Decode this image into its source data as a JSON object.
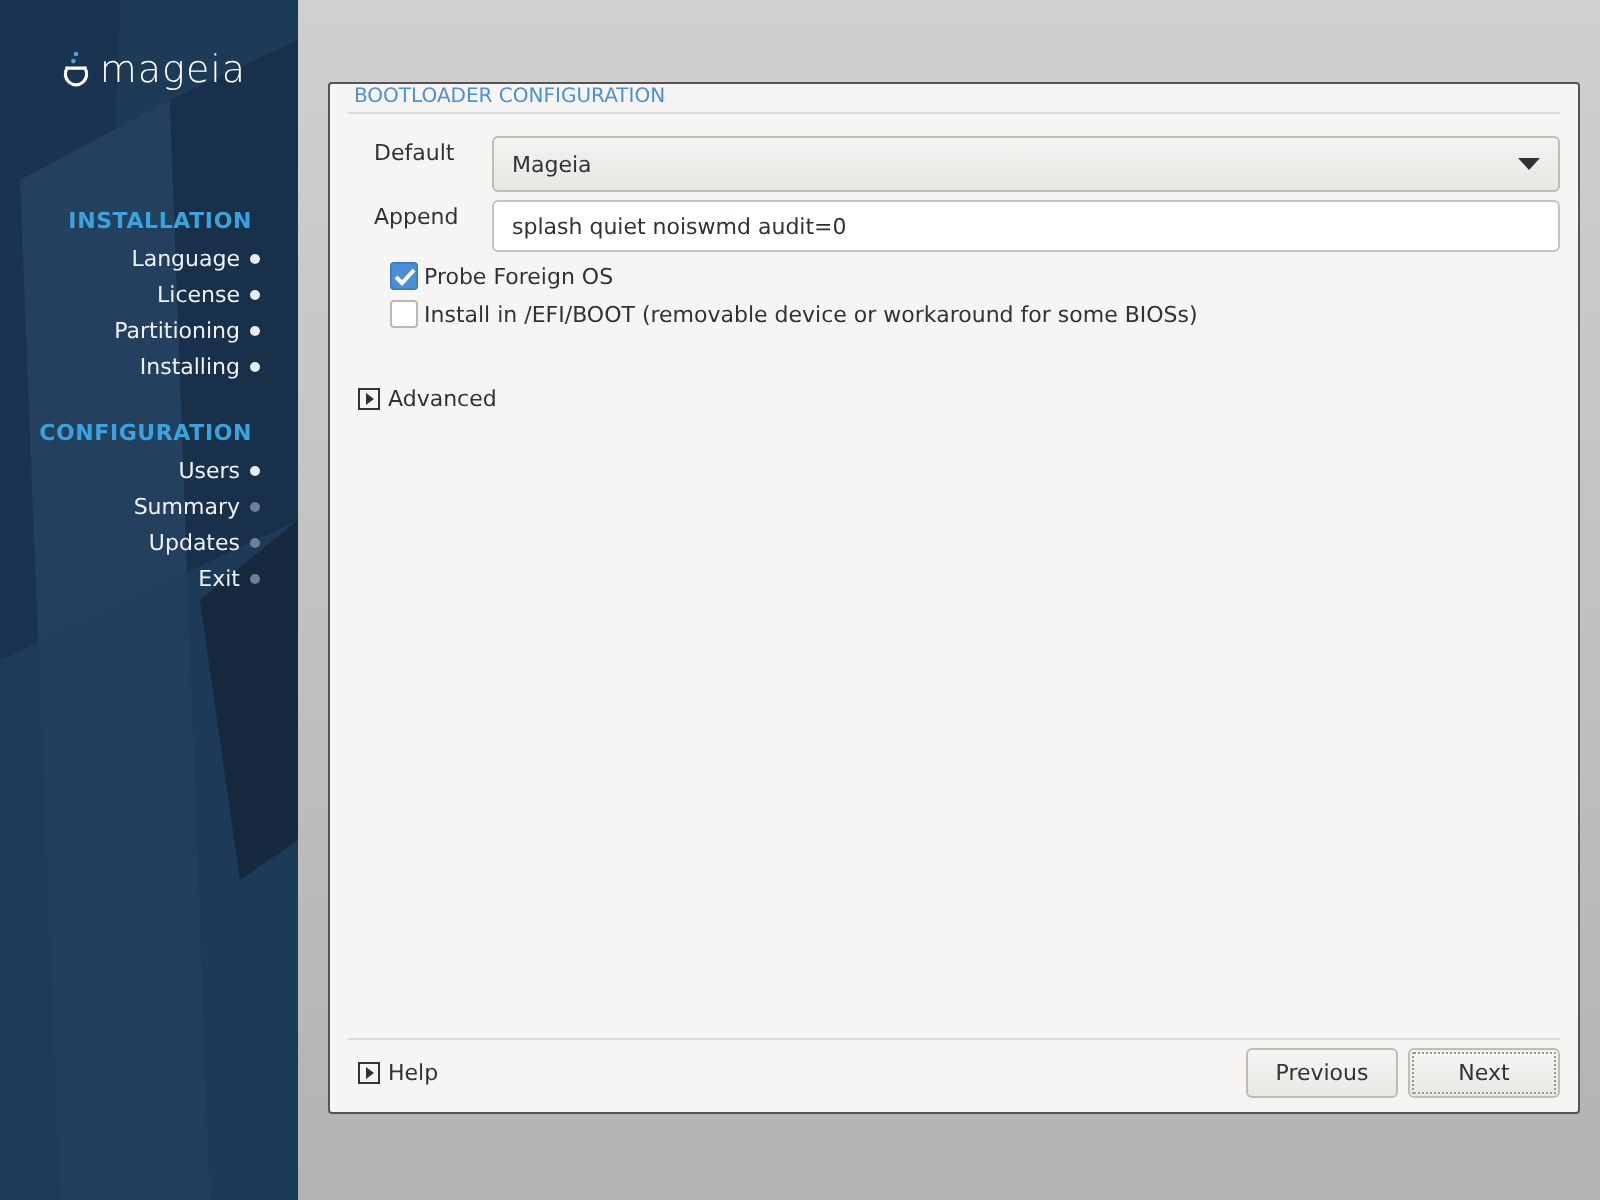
{
  "sidebar": {
    "logo": "mageia",
    "sections": [
      {
        "title": "INSTALLATION",
        "steps": [
          {
            "label": "Language",
            "done": true
          },
          {
            "label": "License",
            "done": true
          },
          {
            "label": "Partitioning",
            "done": true
          },
          {
            "label": "Installing",
            "done": true
          }
        ]
      },
      {
        "title": "CONFIGURATION",
        "steps": [
          {
            "label": "Users",
            "done": true
          },
          {
            "label": "Summary",
            "done": false
          },
          {
            "label": "Updates",
            "done": false
          },
          {
            "label": "Exit",
            "done": false
          }
        ]
      }
    ]
  },
  "dialog": {
    "title": "BOOTLOADER CONFIGURATION",
    "default": {
      "label": "Default",
      "value": "Mageia"
    },
    "append": {
      "label": "Append",
      "value": "splash quiet noiswmd audit=0"
    },
    "options": [
      {
        "label": "Probe Foreign OS",
        "checked": true
      },
      {
        "label": "Install in /EFI/BOOT (removable device or workaround for some BIOSs)",
        "checked": false
      }
    ],
    "advanced": {
      "label": "Advanced",
      "expanded": false
    },
    "help": {
      "label": "Help",
      "expanded": false
    },
    "buttons": [
      {
        "label": "Previous",
        "focused": false
      },
      {
        "label": "Next",
        "focused": true
      }
    ]
  }
}
